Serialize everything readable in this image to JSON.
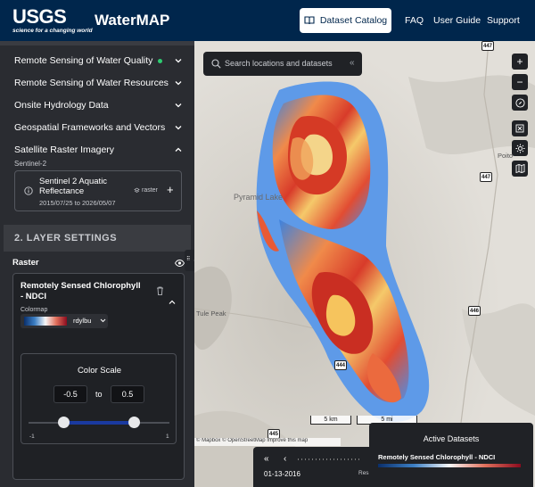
{
  "header": {
    "logo_text": "USGS",
    "logo_tagline": "science for a changing world",
    "app_title": "WaterMAP",
    "catalog_button": "Dataset Catalog",
    "nav": [
      "FAQ",
      "User Guide",
      "Support"
    ]
  },
  "sidebar": {
    "categories": [
      {
        "label": "Remote Sensing of Water Quality",
        "active_dot": true,
        "expanded": false
      },
      {
        "label": "Remote Sensing of Water Resources",
        "expanded": false
      },
      {
        "label": "Onsite Hydrology Data",
        "expanded": false
      },
      {
        "label": "Geospatial Frameworks and Vectors",
        "expanded": false
      },
      {
        "label": "Satellite Raster Imagery",
        "expanded": true
      }
    ],
    "sub_group": "Sentinel-2",
    "dataset": {
      "name": "Sentinel 2 Aquatic Reflectance",
      "dates": "2015/07/25 to 2026/05/07",
      "type": "raster"
    },
    "section_title": "2. LAYER SETTINGS",
    "layer_group": "Raster",
    "layer": {
      "name": "Remotely Sensed Chlorophyll - NDCI",
      "colormap_label": "Colormap",
      "colormap_value": "rdylbu",
      "color_scale": {
        "title": "Color Scale",
        "min_value": "-0.5",
        "to_label": "to",
        "max_value": "0.5",
        "range_min_label": "-1",
        "range_max_label": "1",
        "range_min": -1,
        "range_max": 1,
        "selected_min": -0.5,
        "selected_max": 0.5
      }
    }
  },
  "map": {
    "search_placeholder": "Search locations and datasets",
    "controls": [
      "+",
      "−"
    ],
    "road_shields": [
      "447",
      "447",
      "446",
      "444",
      "445"
    ],
    "places": [
      "Tule Peak",
      "Pyramid Lake",
      "Poito"
    ],
    "scale_km": "5 km",
    "scale_mi": "5 mi",
    "attribution": "© Mapbox © OpenStreetMap Improve this map",
    "timeline": {
      "date": "01-13-2016",
      "reset_label": "Res"
    },
    "active_datasets": {
      "title": "Active Datasets",
      "layer_name": "Remotely Sensed Chlorophyll - NDCI"
    }
  }
}
